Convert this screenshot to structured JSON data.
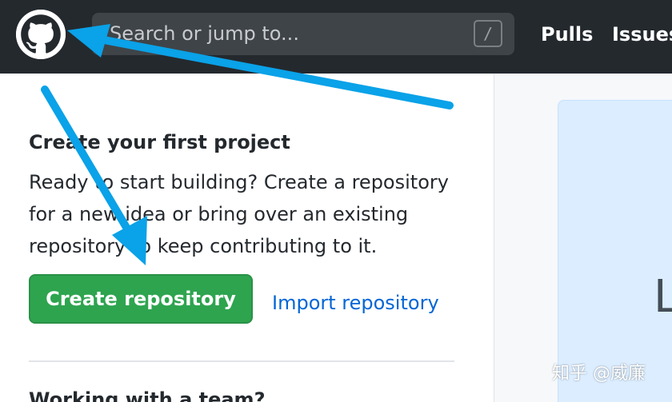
{
  "header": {
    "search_placeholder": "Search or jump to...",
    "search_shortcut": "/",
    "nav": {
      "pulls": "Pulls",
      "issues": "Issues"
    }
  },
  "main": {
    "project": {
      "title": "Create your first project",
      "description": "Ready to start building? Create a repository for a new idea or bring over an existing repository to keep contributing to it.",
      "create_button": "Create repository",
      "import_link": "Import repository"
    },
    "team": {
      "title": "Working with a team?"
    }
  },
  "sidebar": {
    "learn_letter": "L"
  },
  "watermark": "知乎 @威廉",
  "colors": {
    "header_bg": "#24292e",
    "primary_green": "#2ea44f",
    "link_blue": "#0366d6",
    "arrow_blue": "#0aa2e8"
  }
}
